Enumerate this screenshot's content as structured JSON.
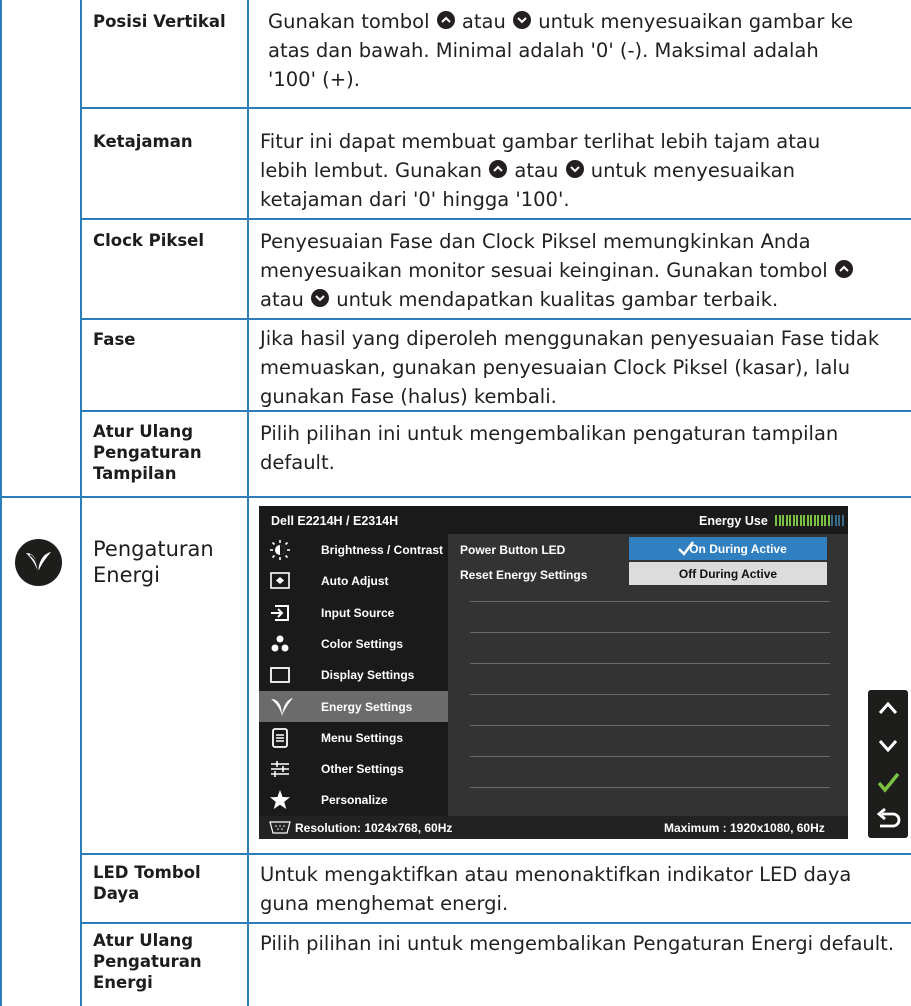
{
  "table": {
    "rows": [
      {
        "label": "Posisi Vertikal",
        "desc_parts": [
          "Gunakan tombol ",
          " atau ",
          " untuk menyesuaikan gambar ke atas dan bawah. Minimal adalah '0' (-). Maksimal adalah '100' (+)."
        ]
      },
      {
        "label": "Ketajaman",
        "desc_parts": [
          "Fitur ini dapat membuat gambar terlihat lebih tajam atau lebih lembut. Gunakan ",
          " atau ",
          " untuk menyesuaikan ketajaman dari '0' hingga '100'."
        ]
      },
      {
        "label": "Clock Piksel",
        "desc_parts": [
          "Penyesuaian Fase dan Clock Piksel memungkinkan Anda menyesuaikan monitor sesuai keinginan. Gunakan tombol ",
          " atau ",
          " untuk mendapatkan kualitas gambar terbaik."
        ]
      },
      {
        "label": "Fase",
        "desc": "Jika hasil yang diperoleh menggunakan penyesuaian Fase tidak memuaskan, gunakan penyesuaian Clock Piksel (kasar), lalu gunakan Fase (halus) kembali."
      },
      {
        "label": "Atur Ulang Pengaturan Tampilan",
        "desc": "Pilih pilihan ini untuk mengembalikan pengaturan tampilan default."
      }
    ],
    "energy_title": "Pengaturan Energi",
    "bottom_rows": [
      {
        "label": "LED Tombol Daya",
        "desc": "Untuk mengaktifkan atau menonaktifkan indikator LED daya guna menghemat energi."
      },
      {
        "label": "Atur Ulang Pengaturan Energi",
        "desc": "Pilih pilihan ini untuk mengembalikan Pengaturan Energi default."
      }
    ]
  },
  "osd": {
    "model": "Dell E2214H / E2314H",
    "energy_use_label": "Energy Use",
    "energy_level": 0.78,
    "menu": [
      {
        "label": "Brightness / Contrast",
        "icon": "brightness-icon"
      },
      {
        "label": "Auto Adjust",
        "icon": "auto-adjust-icon"
      },
      {
        "label": "Input Source",
        "icon": "input-source-icon"
      },
      {
        "label": "Color Settings",
        "icon": "color-settings-icon"
      },
      {
        "label": "Display Settings",
        "icon": "display-settings-icon"
      },
      {
        "label": "Energy Settings",
        "icon": "energy-leaf-icon",
        "active": true
      },
      {
        "label": "Menu Settings",
        "icon": "menu-settings-icon"
      },
      {
        "label": "Other Settings",
        "icon": "other-settings-icon"
      },
      {
        "label": "Personalize",
        "icon": "star-icon"
      }
    ],
    "sub": [
      {
        "label": "Power Button LED",
        "option": "On During Active"
      },
      {
        "label": "Reset Energy Settings",
        "option": "Off During Active"
      }
    ],
    "resolution": "Resolution: 1024x768,  60Hz",
    "maximum": "Maximum : 1920x1080,  60Hz",
    "colors": {
      "selected": "#2f7fc1",
      "active_item": "#6b6b6b",
      "energy_bar": "#7cc242"
    }
  },
  "nav_buttons": [
    "up-arrow-icon",
    "down-arrow-icon",
    "check-icon",
    "back-icon"
  ]
}
